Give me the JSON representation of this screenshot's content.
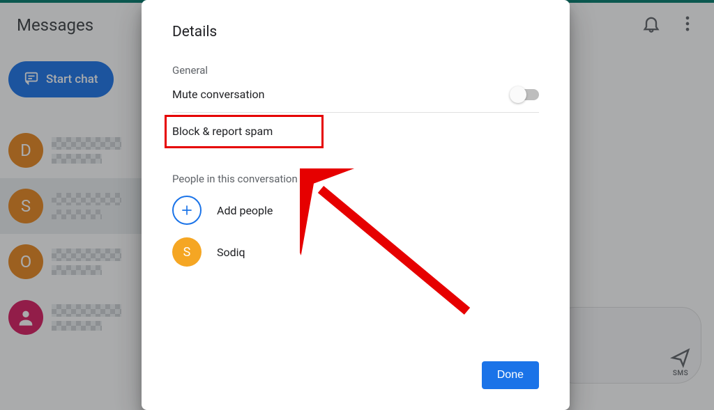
{
  "app": {
    "title": "Messages",
    "start_chat": "Start chat",
    "send_sms": "SMS"
  },
  "chatlist": [
    {
      "initial": "D"
    },
    {
      "initial": "S"
    },
    {
      "initial": "O"
    },
    {
      "initial": ""
    }
  ],
  "dialog": {
    "title": "Details",
    "section_general": "General",
    "mute_label": "Mute conversation",
    "mute_on": false,
    "block_label": "Block & report spam",
    "section_people": "People in this conversation",
    "add_people": "Add people",
    "people": [
      {
        "name": "Sodiq",
        "initial": "S"
      }
    ],
    "done": "Done"
  }
}
